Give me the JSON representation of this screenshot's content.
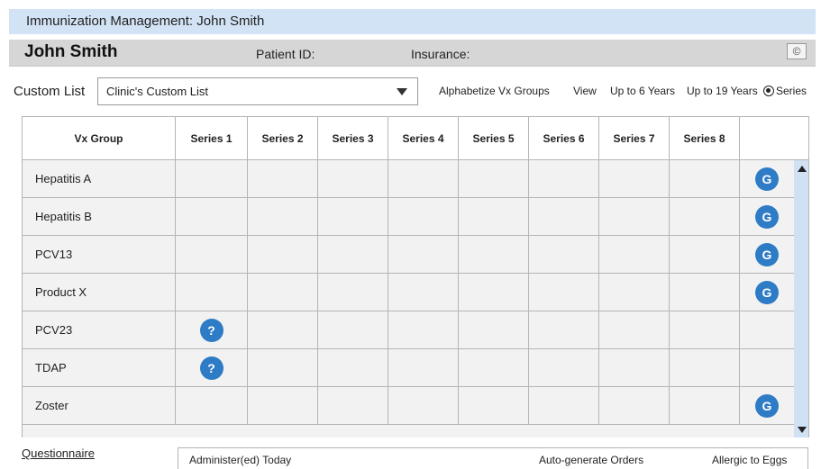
{
  "window": {
    "title": "Immunization Management: John Smith"
  },
  "patient": {
    "name": "John Smith",
    "id_label": "Patient ID:",
    "insurance_label": "Insurance:",
    "copy_symbol": "©"
  },
  "toolbar": {
    "custom_list_label": "Custom List",
    "custom_list_value": "Clinic's Custom List",
    "alphabetize": "Alphabetize Vx Groups",
    "view": "View",
    "up_to_6": "Up to 6 Years",
    "up_to_19": "Up to 19 Years",
    "series": "Series",
    "selected_view": "Series"
  },
  "grid": {
    "columns": [
      "Vx Group",
      "Series 1",
      "Series 2",
      "Series 3",
      "Series 4",
      "Series 5",
      "Series 6",
      "Series 7",
      "Series 8",
      ""
    ],
    "rows": [
      {
        "name": "Hepatitis A",
        "series1_badge": "",
        "g_badge": "G"
      },
      {
        "name": "Hepatitis B",
        "series1_badge": "",
        "g_badge": "G"
      },
      {
        "name": "PCV13",
        "series1_badge": "",
        "g_badge": "G"
      },
      {
        "name": "Product X",
        "series1_badge": "",
        "g_badge": "G"
      },
      {
        "name": "PCV23",
        "series1_badge": "?",
        "g_badge": ""
      },
      {
        "name": "TDAP",
        "series1_badge": "?",
        "g_badge": ""
      },
      {
        "name": "Zoster",
        "series1_badge": "",
        "g_badge": "G"
      }
    ]
  },
  "footer": {
    "questionnaire": "Questionnaire",
    "administered_today": "Administer(ed) Today",
    "auto_generate": "Auto-generate Orders",
    "allergic_eggs": "Allergic to Eggs"
  },
  "colors": {
    "title_bar": "#d2e3f5",
    "patient_bar": "#d6d6d6",
    "badge": "#2e7bc6",
    "grid_fill": "#f2f2f2",
    "scrollbar": "#cfe1f3"
  }
}
